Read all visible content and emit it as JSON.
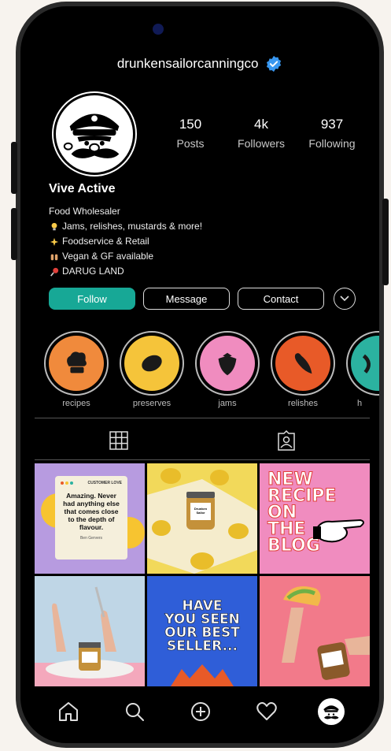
{
  "profile": {
    "username": "drunkensailorcanningco",
    "display_name": "Vive Active",
    "category": "Food Wholesaler",
    "bio_lines": [
      "Jams, relishes, mustards & more!",
      "Foodservice & Retail",
      "Vegan & GF available",
      "DARUG LAND"
    ]
  },
  "stats": {
    "posts": {
      "value": "150",
      "label": "Posts"
    },
    "followers": {
      "value": "4k",
      "label": "Followers"
    },
    "following": {
      "value": "937",
      "label": "Following"
    }
  },
  "buttons": {
    "follow": "Follow",
    "message": "Message",
    "contact": "Contact"
  },
  "highlights": [
    {
      "label": "recipes",
      "color": "#f08a3c",
      "icon": "chef-hat-icon"
    },
    {
      "label": "preserves",
      "color": "#f5c43a",
      "icon": "lemon-icon"
    },
    {
      "label": "jams",
      "color": "#f08cbf",
      "icon": "strawberry-icon"
    },
    {
      "label": "relishes",
      "color": "#e85a28",
      "icon": "chili-icon"
    },
    {
      "label": "h",
      "color": "#2bb2a0",
      "icon": "smile-icon"
    }
  ],
  "posts": {
    "p1": {
      "header": "CUSTOMER LOVE",
      "quote": "Amazing. Never had anything else that comes close to the depth of flavour.",
      "author": "Ben Gervers"
    },
    "p2": {
      "jar_label": "Drunken Sailor"
    },
    "p3": {
      "line1": "NEW",
      "line2": "RECIPE",
      "line3": "ON",
      "line4": "THE",
      "line5": "BLOG"
    },
    "p5": {
      "line1": "HAVE",
      "line2": "YOU SEEN",
      "line3": "OUR BEST",
      "line4": "SELLER..."
    }
  },
  "colors": {
    "accent": "#17a896",
    "verified": "#3897f0"
  }
}
